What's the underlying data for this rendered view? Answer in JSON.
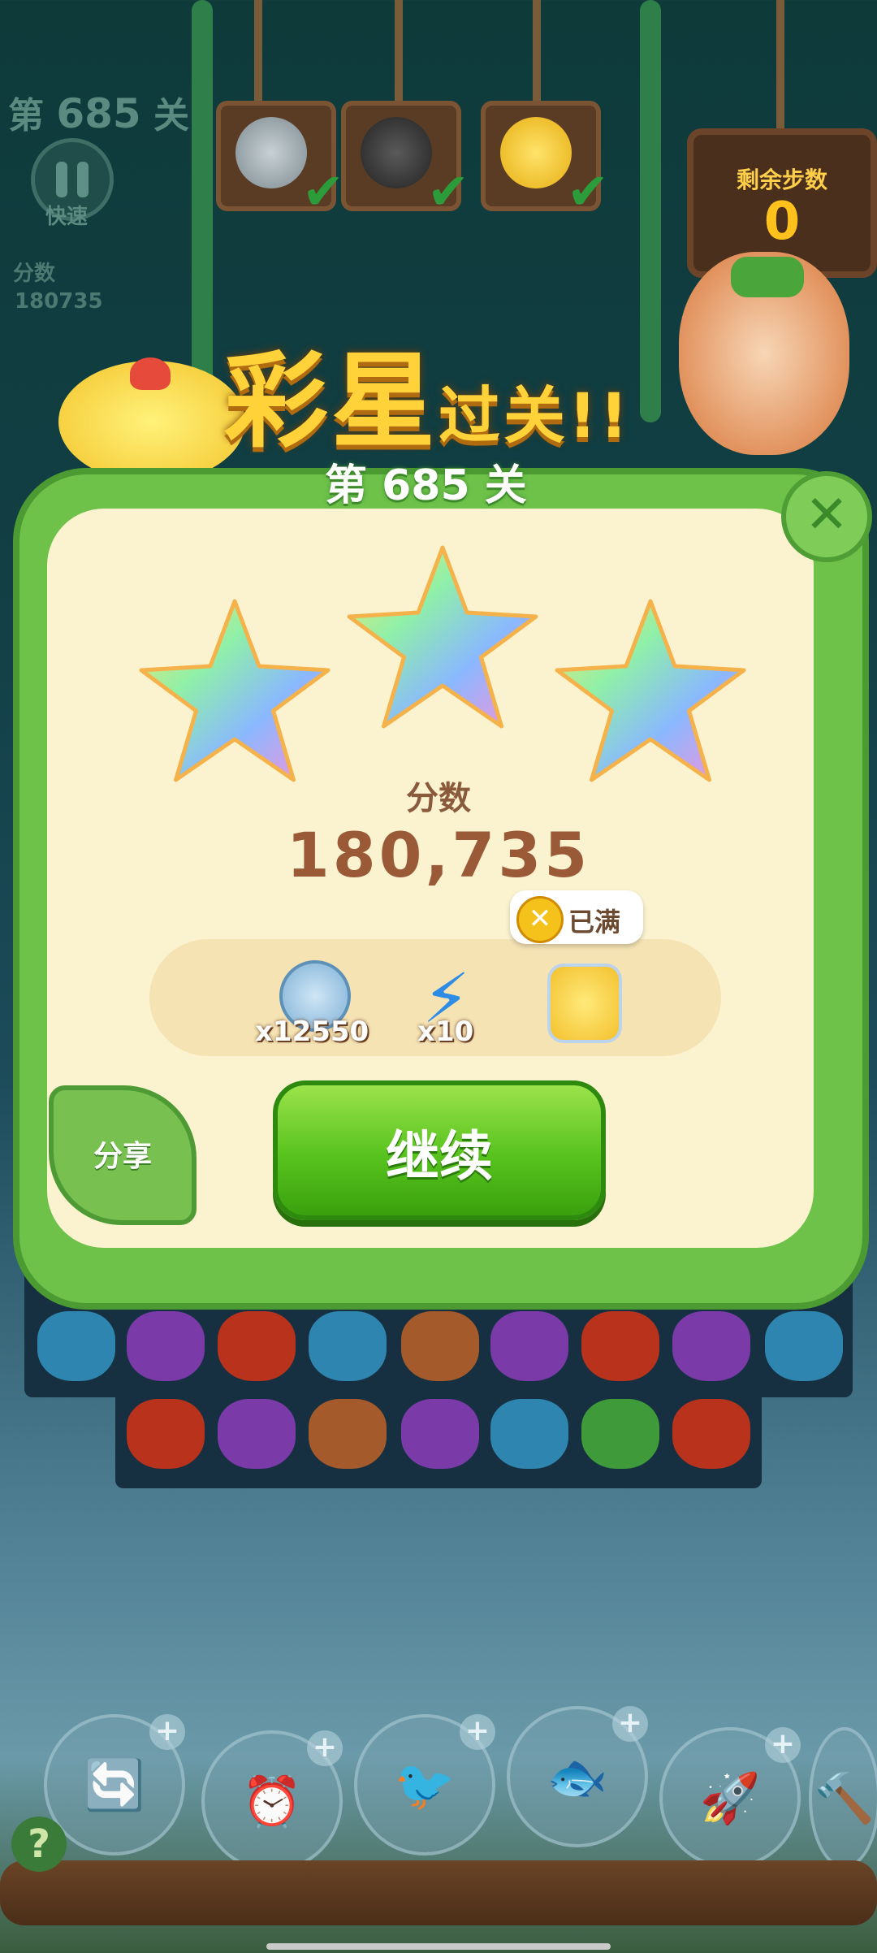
{
  "hud": {
    "level_prefix": "第",
    "level_number": "685",
    "level_suffix": "关",
    "speed_label": "快速",
    "score_label": "分数",
    "score_value": "180735",
    "moves_title": "剩余步数",
    "moves_value": "0",
    "goals": [
      {
        "icon": "coin-goal-icon",
        "color": "#9aa7ad",
        "done": true
      },
      {
        "icon": "dark-bird-goal-icon",
        "color": "#3a3a3a",
        "done": true
      },
      {
        "icon": "gold-goal-icon",
        "color": "#f0c22a",
        "done": true
      }
    ]
  },
  "dialog": {
    "title_main": "彩星",
    "title_tail": "过关!!",
    "level_banner": "第 685 关",
    "stars_earned": 3,
    "score_title": "分数",
    "score_value": "180,735",
    "rewards": [
      {
        "icon": "coin-icon",
        "count": "x12550"
      },
      {
        "icon": "lightning-icon",
        "count": "x10"
      },
      {
        "icon": "star-jar-icon",
        "count": ""
      }
    ],
    "jar_tooltip": "已满",
    "continue_label": "继续",
    "share_label": "分享",
    "close_icon": "close-icon"
  },
  "boosters": [
    {
      "icon": "shuffle-booster-icon",
      "glyph": "🔄"
    },
    {
      "icon": "clock-booster-icon",
      "glyph": "⏰"
    },
    {
      "icon": "swap-booster-icon",
      "glyph": "🐦"
    },
    {
      "icon": "row-blast-booster-icon",
      "glyph": "🐟"
    },
    {
      "icon": "rocket-booster-icon",
      "glyph": "🚀"
    },
    {
      "icon": "hammer-booster-icon",
      "glyph": "🔨"
    }
  ],
  "help_label": "?"
}
